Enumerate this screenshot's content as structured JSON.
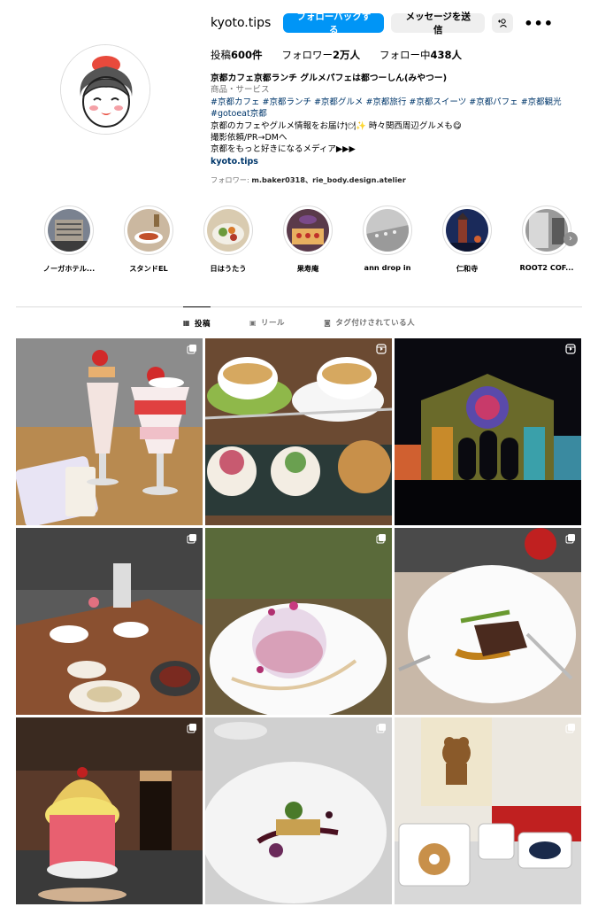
{
  "profile": {
    "username": "kyoto.tips",
    "follow_back_label": "フォローバックする",
    "message_label": "メッセージを送信",
    "more_label": "•••",
    "stats": [
      {
        "label": "投稿",
        "value": "600件"
      },
      {
        "label": "フォロワー",
        "value": "2万人"
      },
      {
        "label": "フォロー中",
        "value": "438人"
      }
    ],
    "bio": {
      "name": "京都カフェ京都ランチ グルメパフェは都つーしん(みやつー)",
      "category": "商品・サービス",
      "tags_line1": "#京都カフェ #京都ランチ #京都グルメ #京都旅行 #京都スイーツ #京都パフェ #京都観光",
      "tags_line2": "#gotoeat京都",
      "line1": "京都のカフェやグルメ情報をお届け🍽✨ 時々関西周辺グルメも😋",
      "line2": "撮影依頼/PR→DMへ",
      "line3": "京都をもっと好きになるメディア▶▶▶",
      "link": "kyoto.tips"
    },
    "followed_by_prefix": "フォロワー: ",
    "followed_by_names": "m.baker0318、rie_body.design.atelier"
  },
  "highlights": [
    {
      "label": "ノーガホテル..."
    },
    {
      "label": "スタンドEL"
    },
    {
      "label": "日はうたう"
    },
    {
      "label": "果寿庵"
    },
    {
      "label": "ann drop in"
    },
    {
      "label": "仁和寺"
    },
    {
      "label": "ROOT2 COF..."
    }
  ],
  "tabs": [
    {
      "label": "投稿",
      "icon": "grid-icon",
      "active": true
    },
    {
      "label": "リール",
      "icon": "reels-icon",
      "active": false
    },
    {
      "label": "タグ付けされている人",
      "icon": "tagged-icon",
      "active": false
    }
  ],
  "posts": [
    {
      "type": "carousel"
    },
    {
      "type": "reel"
    },
    {
      "type": "reel"
    },
    {
      "type": "carousel"
    },
    {
      "type": "carousel"
    },
    {
      "type": "carousel"
    },
    {
      "type": "carousel"
    },
    {
      "type": "carousel"
    },
    {
      "type": "carousel"
    }
  ],
  "colors": {
    "accent": "#0095f6",
    "link": "#00376b",
    "muted": "#737373",
    "border": "#dbdbdb"
  }
}
